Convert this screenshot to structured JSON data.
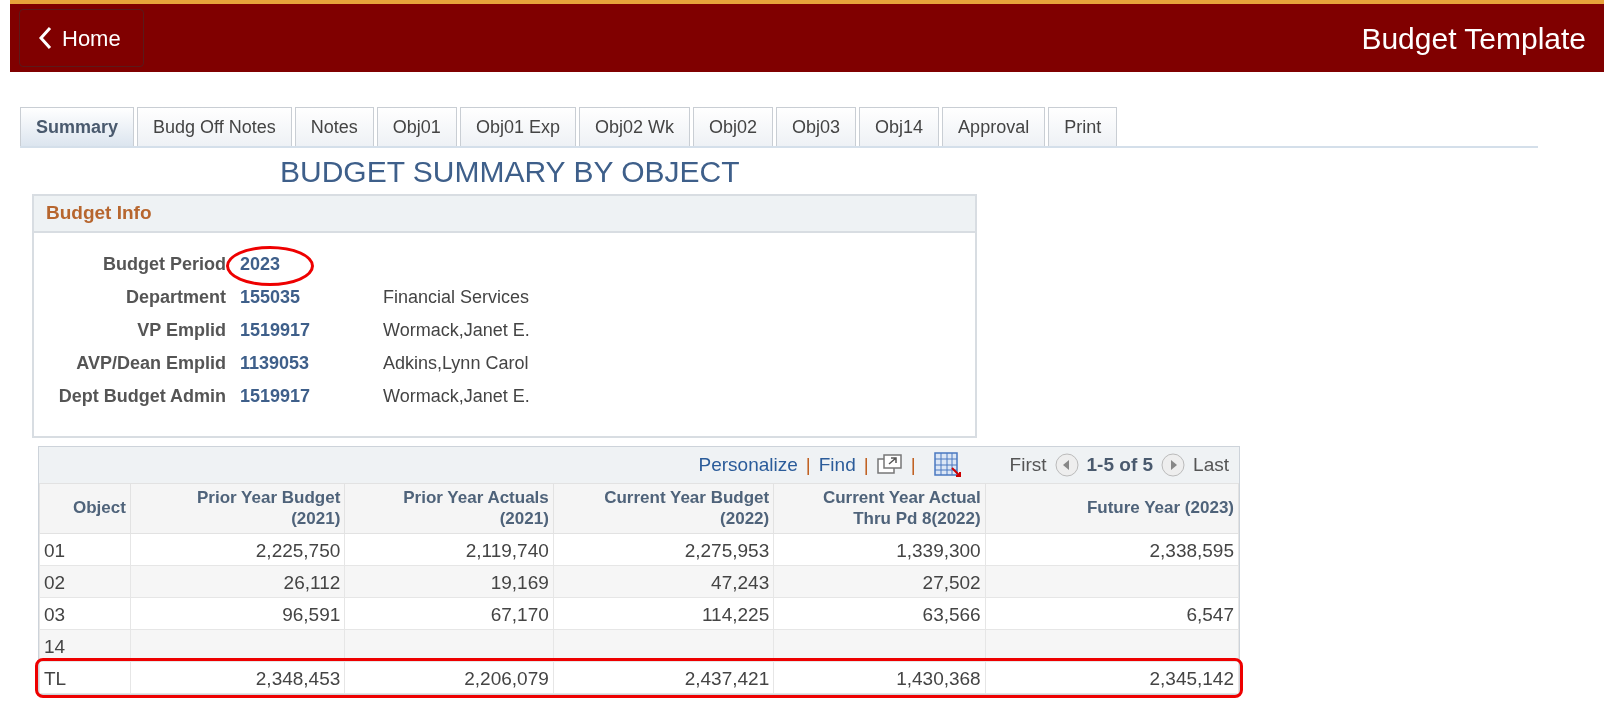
{
  "header": {
    "back_button": "Home",
    "title": "Budget Template"
  },
  "tabs": [
    {
      "label": "Summary",
      "selected": true
    },
    {
      "label": "Budg Off Notes",
      "selected": false
    },
    {
      "label": "Notes",
      "selected": false
    },
    {
      "label": "Obj01",
      "selected": false
    },
    {
      "label": "Obj01 Exp",
      "selected": false
    },
    {
      "label": "Obj02 Wk",
      "selected": false
    },
    {
      "label": "Obj02",
      "selected": false
    },
    {
      "label": "Obj03",
      "selected": false
    },
    {
      "label": "Obj14",
      "selected": false
    },
    {
      "label": "Approval",
      "selected": false
    },
    {
      "label": "Print",
      "selected": false
    }
  ],
  "page_title": "BUDGET SUMMARY BY OBJECT",
  "budget_info": {
    "title": "Budget Info",
    "fields": [
      {
        "label": "Budget Period",
        "value": "2023",
        "circled": true
      },
      {
        "label": "Department",
        "value": "155035",
        "description": "Financial Services",
        "circled": false
      },
      {
        "label": "VP Emplid",
        "value": "1519917",
        "description": "Wormack,Janet E.",
        "circled": false
      },
      {
        "label": "AVP/Dean Emplid",
        "value": "1139053",
        "description": "Adkins,Lynn Carol",
        "circled": false
      },
      {
        "label": "Dept Budget Admin",
        "value": "1519917",
        "description": "Wormack,Janet E.",
        "circled": false
      }
    ]
  },
  "grid": {
    "toolbar": {
      "personalize": "Personalize",
      "separator": "|",
      "find": "Find",
      "first": "First",
      "range": "1-5 of 5",
      "last": "Last"
    },
    "columns": [
      "Object",
      "Prior Year Budget\n(2021)",
      "Prior Year Actuals\n(2021)",
      "Current Year Budget\n(2022)",
      "Current Year Actual\nThru Pd 8(2022)",
      "Future Year (2023)"
    ],
    "rows": [
      {
        "cells": [
          "01",
          "2,225,750",
          "2,119,740",
          "2,275,953",
          "1,339,300",
          "2,338,595"
        ],
        "highlighted": false
      },
      {
        "cells": [
          "02",
          "26,112",
          "19,169",
          "47,243",
          "27,502",
          ""
        ],
        "highlighted": false
      },
      {
        "cells": [
          "03",
          "96,591",
          "67,170",
          "114,225",
          "63,566",
          "6,547"
        ],
        "highlighted": false
      },
      {
        "cells": [
          "14",
          "",
          "",
          "",
          "",
          ""
        ],
        "highlighted": false
      },
      {
        "cells": [
          "TL",
          "2,348,453",
          "2,206,079",
          "2,437,421",
          "1,430,368",
          "2,345,142"
        ],
        "highlighted": true
      }
    ]
  }
}
